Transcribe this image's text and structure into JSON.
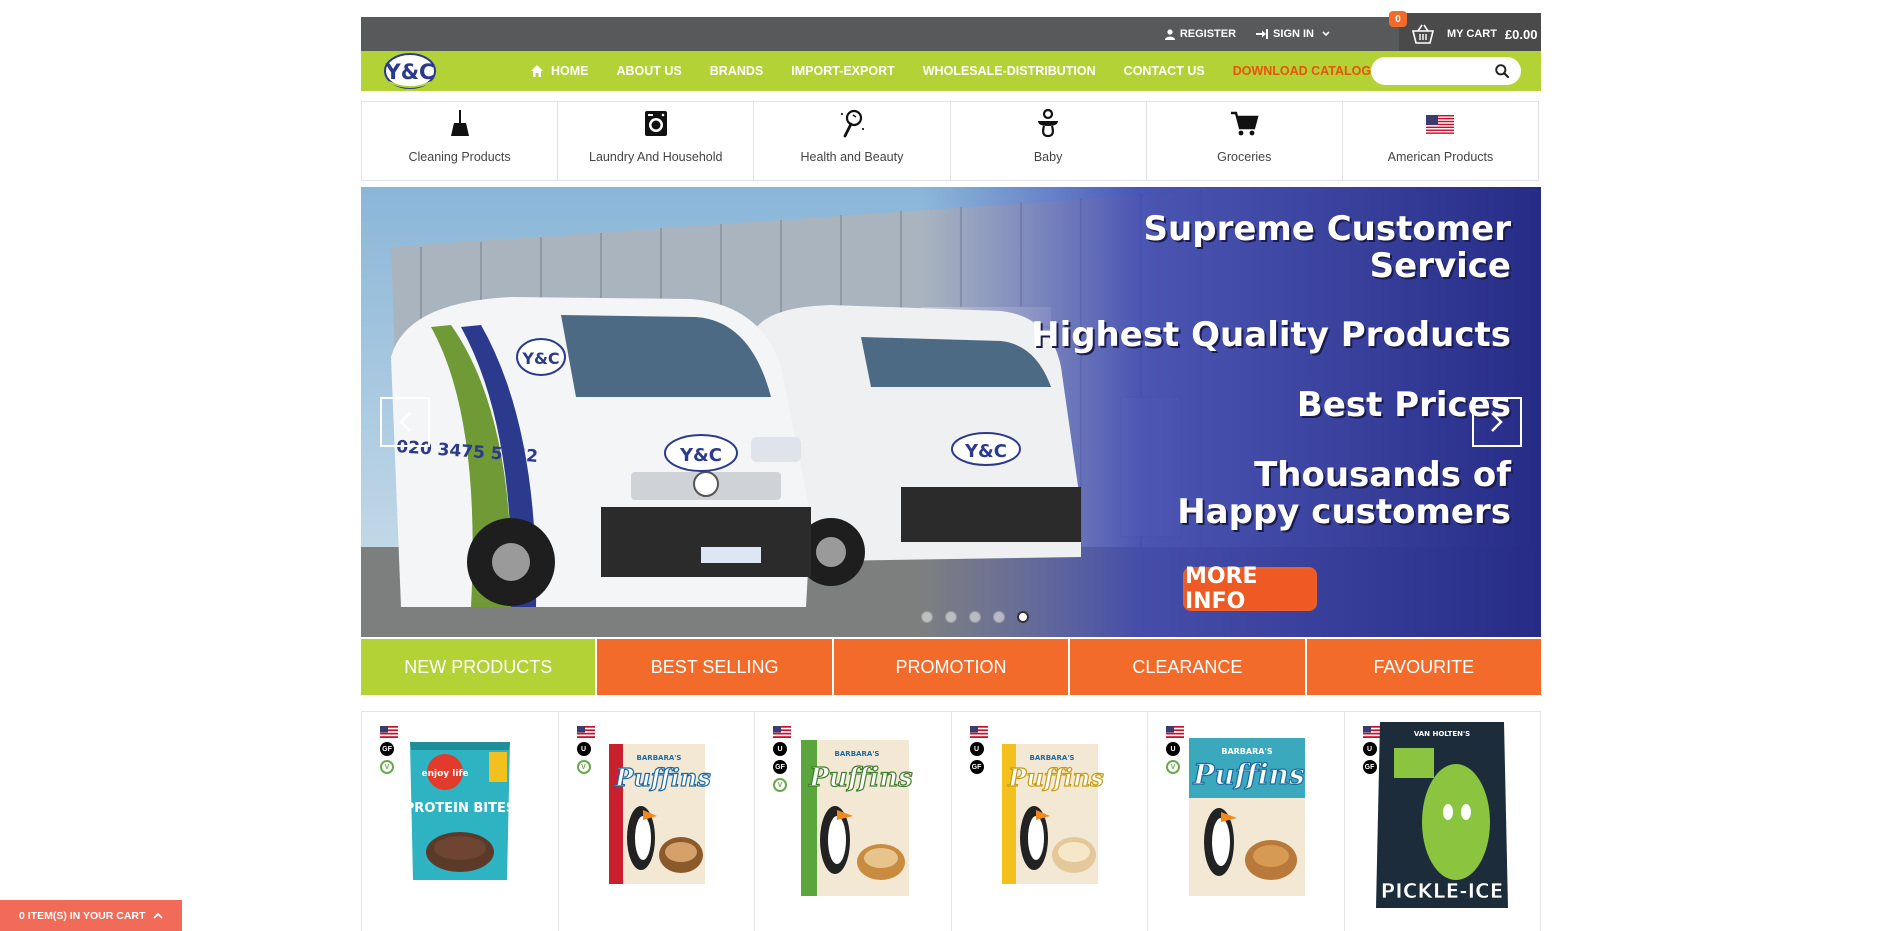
{
  "topbar": {
    "register": "REGISTER",
    "sign_in": "SIGN IN",
    "cart_count": "0",
    "cart_label": "MY CART",
    "cart_amount": "£0.00"
  },
  "nav": {
    "logo_text": "Y&C",
    "items": [
      "HOME",
      "ABOUT US",
      "BRANDS",
      "IMPORT-EXPORT",
      "WHOLESALE-DISTRIBUTION",
      "CONTACT US",
      "DOWNLOAD CATALOGUE"
    ],
    "search_placeholder": ""
  },
  "categories": [
    {
      "label": "Cleaning Products",
      "icon": "broom-icon"
    },
    {
      "label": "Laundry And Household",
      "icon": "washing-machine-icon"
    },
    {
      "label": "Health and Beauty",
      "icon": "mirror-icon"
    },
    {
      "label": "Baby",
      "icon": "pacifier-icon"
    },
    {
      "label": "Groceries",
      "icon": "shopping-cart-icon"
    },
    {
      "label": "American Products",
      "icon": "us-flag-icon"
    }
  ],
  "banner": {
    "line1": "Supreme Customer",
    "line1b": "Service",
    "line2": "Highest Quality Products",
    "line3": "Best Prices",
    "line4": "Thousands of",
    "line4b": "Happy customers",
    "button": "MORE INFO",
    "van_phone": "020 3475 5252",
    "dots": 5,
    "active_dot": 5
  },
  "tabs": [
    "NEW PRODUCTS",
    "BEST SELLING",
    "PROMOTION",
    "CLEARANCE",
    "FAVOURITE"
  ],
  "products": [
    {
      "brand": "enjoy life",
      "name": "PROTEIN BITES",
      "badges": [
        "GF",
        "V"
      ],
      "color": "#2eb3c2"
    },
    {
      "brand": "BARBARA'S",
      "name": "Puffins",
      "badges": [
        "U",
        "V"
      ],
      "color": "#c8202f"
    },
    {
      "brand": "BARBARA'S",
      "name": "Puffins",
      "badges": [
        "U",
        "GF",
        "V"
      ],
      "color": "#5aa63c"
    },
    {
      "brand": "BARBARA'S",
      "name": "Puffins",
      "badges": [
        "U",
        "GF"
      ],
      "color": "#f2c11e"
    },
    {
      "brand": "BARBARA'S",
      "name": "Puffins",
      "badges": [
        "U",
        "V"
      ],
      "color": "#3aa9bd"
    },
    {
      "brand": "VAN HOLTEN'S",
      "name": "PICKLE-ICE",
      "badges": [
        "U",
        "GF"
      ],
      "color": "#8bc53f"
    }
  ],
  "bottom_cart": "0 ITEM(S) IN YOUR CART",
  "colors": {
    "green": "#b3d236",
    "orange": "#f26b2a",
    "dark": "#58595b"
  }
}
